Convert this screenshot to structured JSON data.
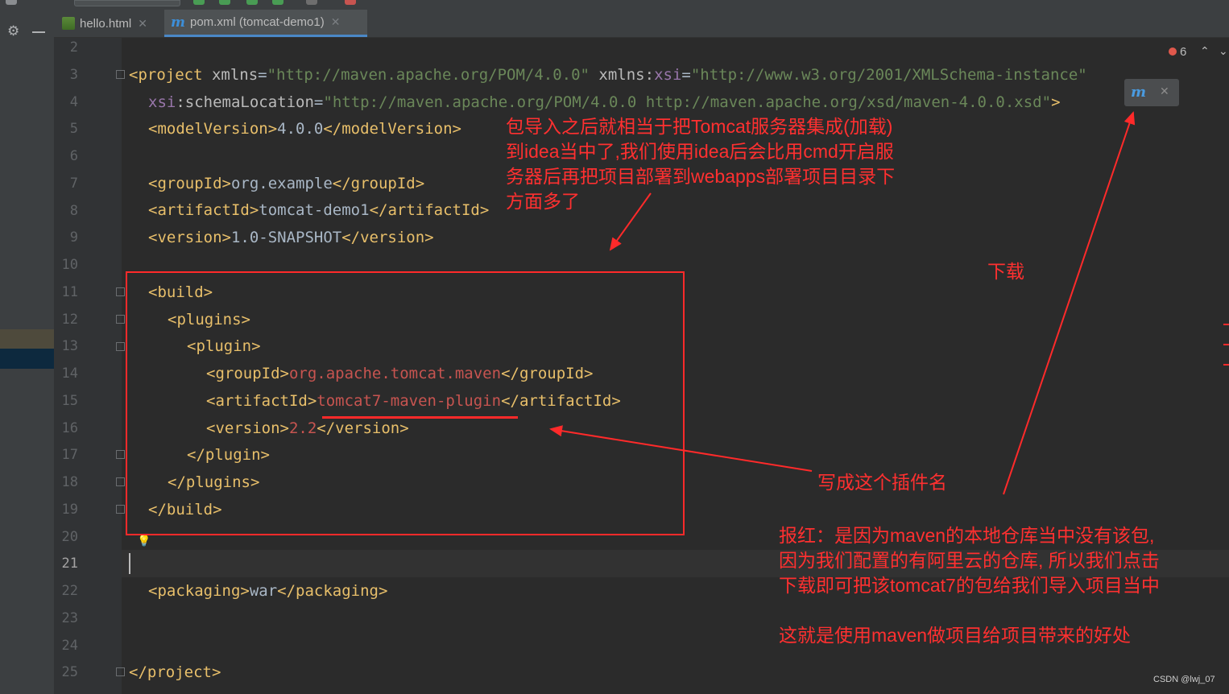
{
  "tabs": [
    {
      "label": "hello.html",
      "icon": "html-file-icon",
      "active": false
    },
    {
      "label": "pom.xml (tomcat-demo1)",
      "icon": "maven-m-icon",
      "active": true
    }
  ],
  "editor": {
    "error_count": "6",
    "current_line": 21
  },
  "line_numbers": [
    "2",
    "3",
    "4",
    "5",
    "6",
    "7",
    "8",
    "9",
    "10",
    "11",
    "12",
    "13",
    "14",
    "15",
    "16",
    "17",
    "18",
    "19",
    "20",
    "21",
    "22",
    "23",
    "24",
    "25"
  ],
  "code": {
    "l3_tag": "<project ",
    "l3_attr1": "xmlns",
    "l3_eq1": "=",
    "l3_val1": "\"http://maven.apache.org/POM/4.0.0\"",
    "l3_attr2": " xmlns:",
    "l3_ns": "xsi",
    "l3_eq2": "=",
    "l3_val2": "\"http://www.w3.org/2001/XMLSchema-instance\"",
    "l4_ns": "xsi",
    "l4_attr": ":schemaLocation",
    "l4_eq": "=",
    "l4_val": "\"http://maven.apache.org/POM/4.0.0 http://maven.apache.org/xsd/maven-4.0.0.xsd\"",
    "l4_end": ">",
    "l5_open": "<modelVersion>",
    "l5_val": "4.0.0",
    "l5_close": "</modelVersion>",
    "l7_open": "<groupId>",
    "l7_val": "org.example",
    "l7_close": "</groupId>",
    "l8_open": "<artifactId>",
    "l8_val": "tomcat-demo1",
    "l8_close": "</artifactId>",
    "l9_open": "<version>",
    "l9_val": "1.0-SNAPSHOT",
    "l9_close": "</version>",
    "l11": "<build>",
    "l12": "<plugins>",
    "l13": "<plugin>",
    "l14_open": "<groupId>",
    "l14_val": "org.apache.tomcat.maven",
    "l14_close": "</groupId>",
    "l15_open": "<artifactId>",
    "l15_val": "tomcat7-maven-plugin",
    "l15_close": "</artifactId>",
    "l16_open": "<version>",
    "l16_val": "2.2",
    "l16_close": "</version>",
    "l17": "</plugin>",
    "l18": "</plugins>",
    "l19": "</build>",
    "l22_open": "<packaging>",
    "l22_val": "war",
    "l22_close": "</packaging>",
    "l25": "</project>"
  },
  "annotations": {
    "note_top": "包导入之后就相当于把Tomcat服务器集成(加载)\n到idea当中了,我们使用idea后会比用cmd开启服\n务器后再把项目部署到webapps部署项目目录下\n方面多了",
    "note_download": "下载",
    "note_plugin": "写成这个插件名",
    "note_bottom": "报红：是因为maven的本地仓库当中没有该包,\n因为我们配置的有阿里云的仓库, 所以我们点击\n下载即可把该tomcat7的包给我们导入项目当中\n\n这就是使用maven做项目给项目带来的好处"
  },
  "annotation_color": "#ff3030",
  "watermark": "CSDN @lwj_07"
}
